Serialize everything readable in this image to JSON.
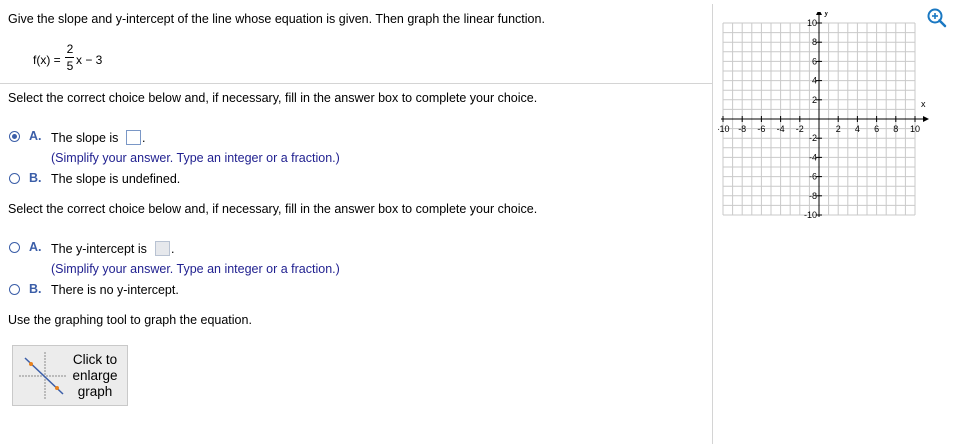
{
  "question": {
    "instruction": "Give the slope and y-intercept of the line whose equation is given. Then graph the linear function.",
    "function_prefix": "f(x) =",
    "numerator": "2",
    "denominator": "5",
    "function_suffix": "x − 3"
  },
  "part1": {
    "prompt": "Select the correct choice below and, if necessary, fill in the answer box to complete your choice.",
    "choice_a_letter": "A.",
    "choice_a_text": "The slope is",
    "choice_a_hint": "(Simplify your answer. Type an integer or a fraction.)",
    "choice_b_letter": "B.",
    "choice_b_text": "The slope is undefined.",
    "selected": "A"
  },
  "part2": {
    "prompt": "Select the correct choice below and, if necessary, fill in the answer box to complete your choice.",
    "choice_a_letter": "A.",
    "choice_a_text": "The y-intercept is",
    "choice_a_hint": "(Simplify your answer. Type an integer or a fraction.)",
    "choice_b_letter": "B.",
    "choice_b_text": "There is no y-intercept.",
    "selected": "none"
  },
  "graphing": {
    "instruction": "Use the graphing tool to graph the equation.",
    "enlarge_button": "Click to enlarge graph"
  },
  "graph": {
    "x_label": "x",
    "y_label": "y",
    "x_min": -10,
    "x_max": 10,
    "y_min": -10,
    "y_max": 10,
    "grid_step": 1,
    "label_step": 2,
    "x_tick_labels": [
      "-10",
      "-8",
      "-6",
      "-4",
      "-2",
      "2",
      "4",
      "6",
      "8",
      "10"
    ],
    "y_tick_labels": [
      "10",
      "8",
      "6",
      "4",
      "2",
      "-2",
      "-4",
      "-6",
      "-8",
      "-10"
    ],
    "zoom_icon": "zoom-in-icon"
  },
  "colors": {
    "accent": "#3b5ea8",
    "hint_text": "#1f1f8f",
    "grid": "#c9c9c9"
  }
}
